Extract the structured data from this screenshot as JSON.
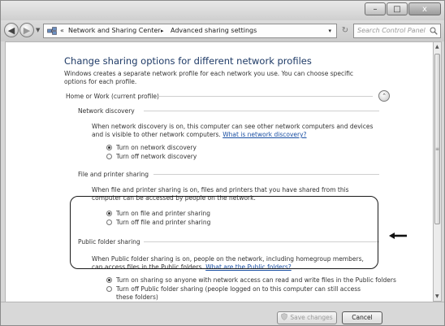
{
  "window_controls": {
    "minimize": "–",
    "maximize": "□",
    "close": "x"
  },
  "address_bar": {
    "chevron": "«",
    "crumbs": [
      "Network and Sharing Center",
      "Advanced sharing settings"
    ],
    "separator": "▸",
    "dropdown": "▾"
  },
  "refresh": "↻",
  "search": {
    "placeholder": "Search Control Panel"
  },
  "page": {
    "title": "Change sharing options for different network profiles",
    "intro": "Windows creates a separate network profile for each network you use. You can choose specific options for each profile."
  },
  "profile": {
    "name": "Home or Work (current profile)",
    "collapse": "⌃"
  },
  "sections": {
    "network_discovery": {
      "title": "Network discovery",
      "desc": "When network discovery is on, this computer can see other network computers and devices and is visible to other network computers.",
      "link": "What is network discovery?",
      "options": [
        "Turn on network discovery",
        "Turn off network discovery"
      ],
      "selected": 0
    },
    "file_printer": {
      "title": "File and printer sharing",
      "desc": "When file and printer sharing is on, files and printers that you have shared from this computer can be accessed by people on the network.",
      "options": [
        "Turn on file and printer sharing",
        "Turn off file and printer sharing"
      ],
      "selected": 0
    },
    "public_folder": {
      "title": "Public folder sharing",
      "desc": "When Public folder sharing is on, people on the network, including homegroup members, can access files in the Public folders.",
      "link": "What are the Public folders?",
      "options": [
        "Turn on sharing so anyone with network access can read and write files in the Public folders",
        "Turn off Public folder sharing (people logged on to this computer can still access these folders)"
      ],
      "selected": 0
    }
  },
  "buttons": {
    "save": "Save changes",
    "cancel": "Cancel"
  },
  "icons": [
    "network-icon",
    "search-icon",
    "shield-icon",
    "arrow-icon"
  ],
  "colors": {
    "heading": "#1e3a66",
    "link": "#1a4fa3",
    "highlight_border": "#1a1a1a"
  }
}
